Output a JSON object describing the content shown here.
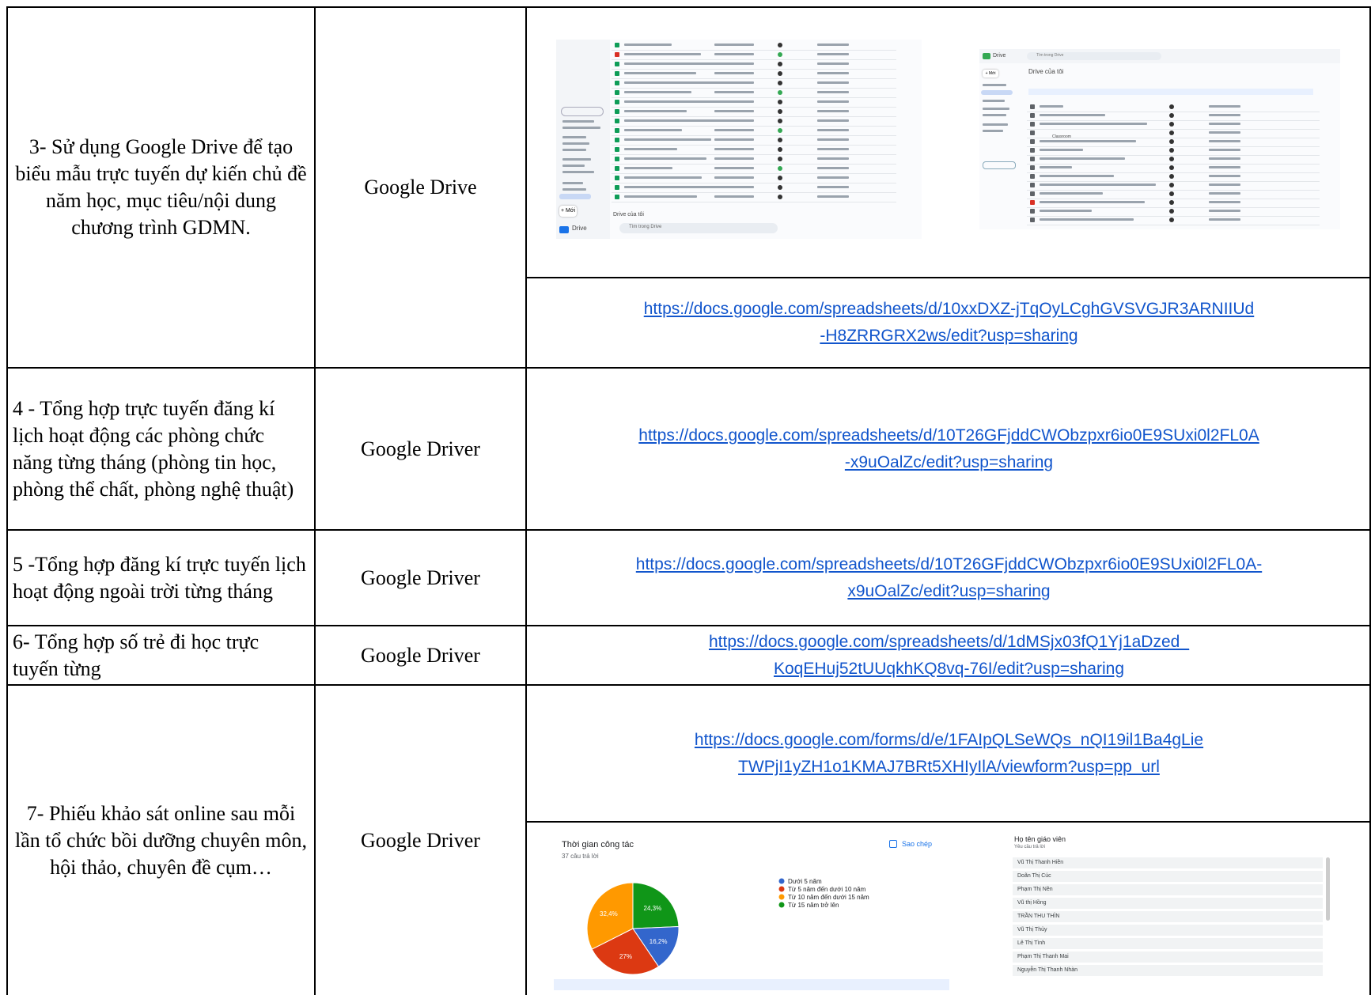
{
  "rows": [
    {
      "task": "3- Sử dụng Google Drive để tạo biểu mẫu trực tuyến dự kiến chủ đề năm học, mục tiêu/nội dung chương trình GDMN.",
      "tool": "Google Drive",
      "link_line1": "https://docs.google.com/spreadsheets/d/10xxDXZ-jTqOyLCghGVSVGJR3ARNIIUd",
      "link_line2": "-H8ZRRGRX2ws/edit?usp=sharing"
    },
    {
      "task": "4 - Tổng hợp trực tuyến đăng kí lịch hoạt động các phòng chức năng từng tháng (phòng tin học, phòng thể chất, phòng nghệ thuật)",
      "tool": "Google Driver",
      "link_line1": "https://docs.google.com/spreadsheets/d/10T26GFjddCWObzpxr6io0E9SUxi0l2FL0A",
      "link_line2": "-x9uOalZc/edit?usp=sharing"
    },
    {
      "task": "5 -Tổng hợp đăng kí trực tuyến lịch hoạt động ngoài trời từng tháng",
      "tool": "Google Driver",
      "link_line1": "https://docs.google.com/spreadsheets/d/10T26GFjddCWObzpxr6io0E9SUxi0l2FL0A-",
      "link_line2": "x9uOalZc/edit?usp=sharing"
    },
    {
      "task": "6- Tổng hợp số trẻ đi học trực tuyến từng",
      "tool": "Google Driver",
      "link_line1": "https://docs.google.com/spreadsheets/d/1dMSjx03fQ1Yj1aDzed_",
      "link_line2": "KoqEHuj52tUUqkhKQ8vq-76I/edit?usp=sharing"
    },
    {
      "task": "7- Phiếu khảo sát online sau mỗi lần tổ chức bồi dưỡng chuyên môn, hội thảo, chuyên đề cụm…",
      "tool": "Google Driver",
      "link_line1": "https://docs.google.com/forms/d/e/1FAIpQLSeWQs_nQI19il1Ba4gLie",
      "link_line2": "TWPjI1yZH1o1KMAJ7BRt5XHIyIlA/viewform?usp=pp_url"
    }
  ],
  "drive_left": {
    "app_name": "Drive",
    "new_label": "+ Mới",
    "search_placeholder": "Tìm trong Drive",
    "section": "Drive của tôi"
  },
  "drive_right": {
    "app_name": "Drive",
    "search_placeholder": "Tìm trong Drive",
    "title": "Drive của tôi",
    "new_label": "+ Mới",
    "folder_name": "Classroom"
  },
  "form_summary": {
    "question": "Thời gian công tác",
    "responses": "37 câu trả lời",
    "copy_label": "Sao chép",
    "colors": [
      "#3366cc",
      "#dc3912",
      "#ff9900",
      "#109618"
    ],
    "chart_data": {
      "type": "pie",
      "categories": [
        "Dưới 5 năm",
        "Từ 5 năm đến dưới 10 năm",
        "Từ 10 năm đến dưới 15 năm",
        "Từ 15 năm trở lên"
      ],
      "values": [
        16.2,
        27,
        32.4,
        24.3
      ],
      "data_labels": [
        "16,2%",
        "27%",
        "32,4%",
        "24,3%"
      ]
    }
  },
  "form_names": {
    "question": "Họ tên giáo viên",
    "responses": "Yêu cầu trả lời",
    "names": [
      "Vũ Thị Thanh Hiền",
      "Doãn Thị Cúc",
      "Phạm Thị Nền",
      "Vũ thị Hồng",
      "TRẦN THU THÌN",
      "Vũ Thị Thủy",
      "Lê Thị Tình",
      "Phạm Thị Thanh Mai",
      "Nguyễn Thị Thanh Nhàn"
    ]
  }
}
